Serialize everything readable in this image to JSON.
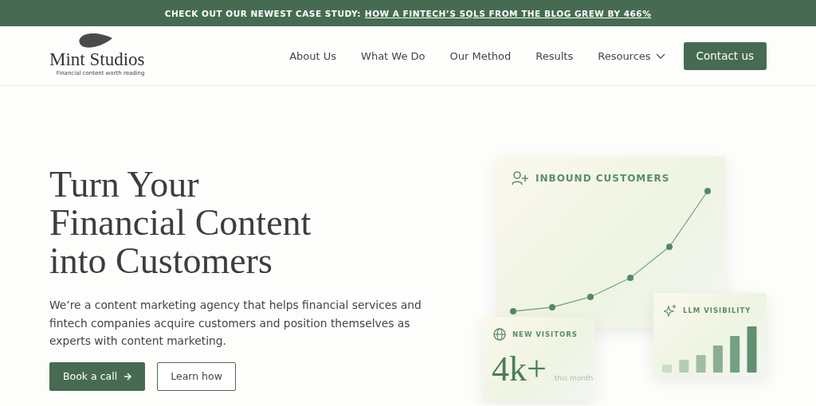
{
  "banner": {
    "text": "CHECK OUT OUR NEWEST CASE STUDY:",
    "link": "HOW A FINTECH’S SQLS FROM THE BLOG GREW BY 466%"
  },
  "header": {
    "logo": {
      "name": "Mint Studios",
      "tagline": "Financial content worth reading"
    },
    "nav": [
      {
        "label": "About Us",
        "dropdown": false
      },
      {
        "label": "What We Do",
        "dropdown": false
      },
      {
        "label": "Our Method",
        "dropdown": false
      },
      {
        "label": "Results",
        "dropdown": false
      },
      {
        "label": "Resources",
        "dropdown": true
      }
    ],
    "cta": "Contact us"
  },
  "hero": {
    "title": [
      "Turn Your",
      "Financial Content",
      "into Customers"
    ],
    "description": "We’re a content marketing agency that helps financial services and fintech companies acquire customers and position themselves as experts with content marketing.",
    "buttons": [
      {
        "label": "Book a call",
        "kind": "primary"
      },
      {
        "label": "Learn how",
        "kind": "secondary"
      }
    ]
  },
  "cards": {
    "inbound": {
      "title": "INBOUND CUSTOMERS"
    },
    "visitors": {
      "title": "NEW VISITORS",
      "value": "4k+",
      "caption": "this month"
    },
    "llm": {
      "title": "LLM VISIBILITY"
    }
  }
}
